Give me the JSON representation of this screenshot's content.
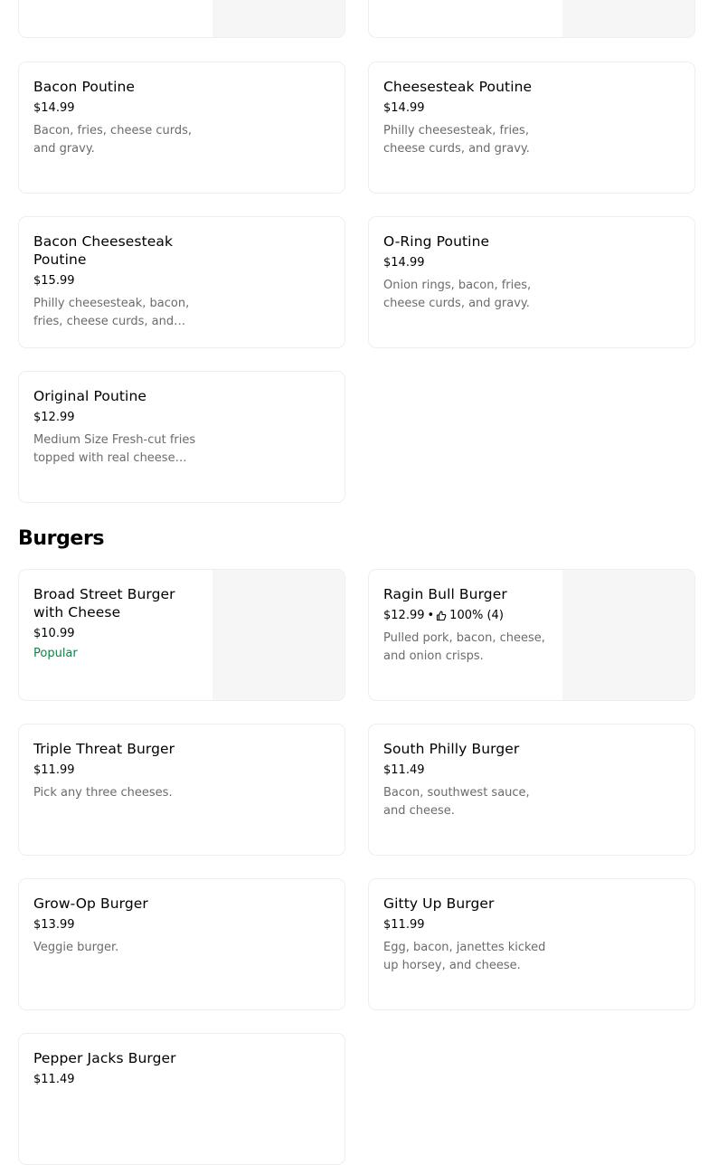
{
  "sections": {
    "poutine": {
      "items": [
        {
          "name": "Bacon Poutine",
          "price": "$14.99",
          "desc": "Bacon, fries, cheese curds, and gravy."
        },
        {
          "name": "Cheesesteak Poutine",
          "price": "$14.99",
          "desc": "Philly cheesesteak, fries, cheese curds, and gravy."
        },
        {
          "name": "Bacon Cheesesteak Poutine",
          "price": "$15.99",
          "desc": "Philly cheesesteak, bacon, fries, cheese curds, and…"
        },
        {
          "name": "O-Ring Poutine",
          "price": "$14.99",
          "desc": "Onion rings, bacon, fries, cheese curds, and gravy."
        },
        {
          "name": "Original Poutine",
          "price": "$12.99",
          "desc": "Medium Size Fresh-cut fries topped with real cheese…"
        }
      ]
    },
    "burgers": {
      "title": "Burgers",
      "items": [
        {
          "name": "Broad Street Burger with Cheese",
          "price": "$10.99",
          "badge": "Popular"
        },
        {
          "name": "Ragin Bull Burger",
          "price": "$12.99",
          "separator": "•",
          "rating": "100% (4)",
          "rating_icon": "thumbs-up-icon",
          "desc": "Pulled pork, bacon, cheese, and onion crisps."
        },
        {
          "name": "Triple Threat Burger",
          "price": "$11.99",
          "desc": "Pick any three cheeses."
        },
        {
          "name": "South Philly Burger",
          "price": "$11.49",
          "desc": "Bacon, southwest sauce, and cheese."
        },
        {
          "name": "Grow-Op Burger",
          "price": "$13.99",
          "desc": "Veggie burger."
        },
        {
          "name": "Gitty Up Burger",
          "price": "$11.99",
          "desc": "Egg, bacon, janettes kicked up horsey, and cheese."
        },
        {
          "name": "Pepper Jacks Burger",
          "price": "$11.49"
        }
      ]
    }
  },
  "colors": {
    "popular": "#0e8345",
    "description": "#6b6b6b",
    "border": "#eeeeee",
    "image_placeholder": "#f6f6f6"
  }
}
